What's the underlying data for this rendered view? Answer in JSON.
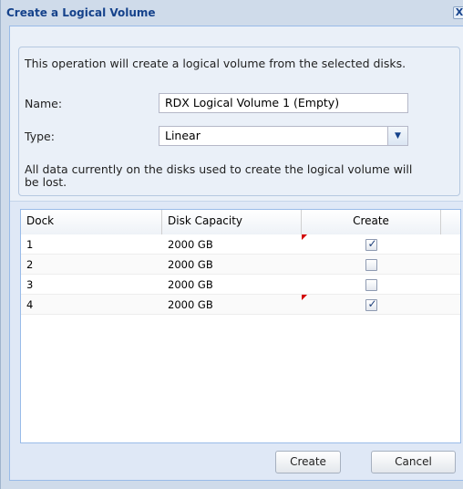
{
  "dialog": {
    "title": "Create a Logical Volume",
    "close_glyph": "X"
  },
  "form": {
    "intro": "This operation will create a logical volume from the selected disks.",
    "name_label": "Name:",
    "name_value": "RDX Logical Volume 1 (Empty)",
    "type_label": "Type:",
    "type_value": "Linear",
    "type_arrow_icon": "chevron-down-icon",
    "warning": "All data currently on the disks used to create the logical volume will be lost."
  },
  "grid": {
    "columns": [
      "Dock",
      "Disk Capacity",
      "Create"
    ],
    "rows": [
      {
        "dock": "1",
        "capacity": "2000 GB",
        "create": true,
        "modified": true
      },
      {
        "dock": "2",
        "capacity": "2000 GB",
        "create": false,
        "modified": false
      },
      {
        "dock": "3",
        "capacity": "2000 GB",
        "create": false,
        "modified": false
      },
      {
        "dock": "4",
        "capacity": "2000 GB",
        "create": true,
        "modified": true
      }
    ]
  },
  "buttons": {
    "create_label": "Create",
    "cancel_label": "Cancel"
  },
  "colors": {
    "title": "#15428b",
    "dirty_marker": "#d30000"
  }
}
